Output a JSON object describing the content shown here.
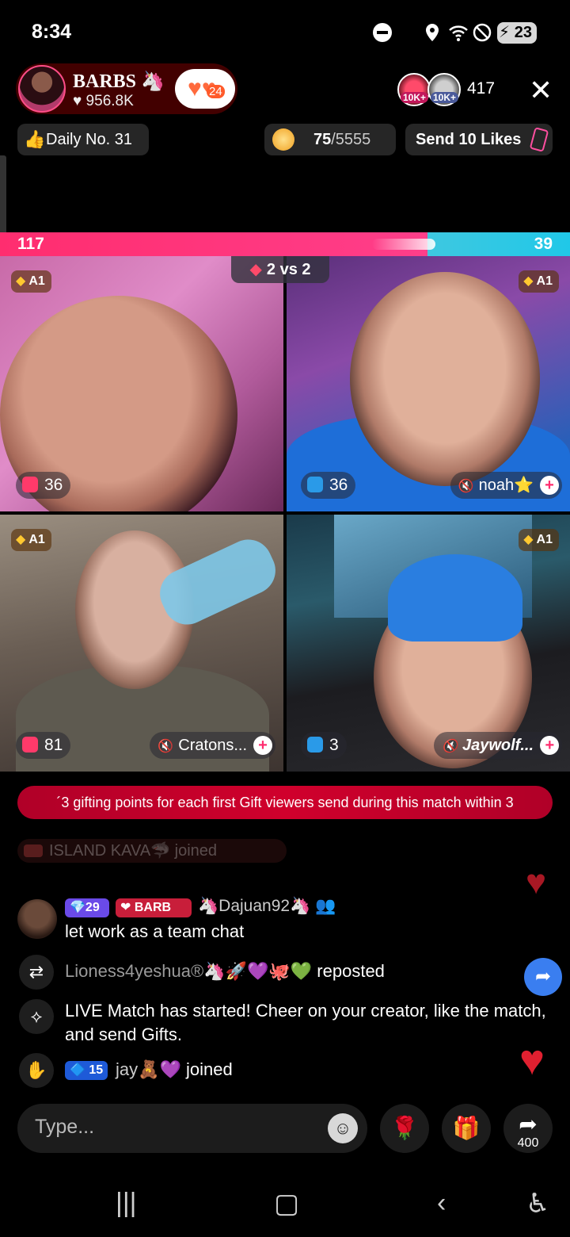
{
  "status_bar": {
    "time": "8:34",
    "battery": "23",
    "icons": [
      "dnd-icon",
      "location-icon",
      "wifi-icon",
      "no-sim-icon",
      "battery-charging-icon"
    ]
  },
  "host": {
    "name": "BARBS 🦄",
    "likes": "♥ 956.8K",
    "follow_count": "24"
  },
  "viewers": {
    "badge_1": "10K+",
    "badge_2": "10K+",
    "count": "417"
  },
  "top_row": {
    "daily": "Daily No. 31",
    "goal_current": "75",
    "goal_total": "/5555",
    "send_likes": "Send 10 Likes"
  },
  "battle": {
    "score_left": "117",
    "score_right": "39",
    "score_left_fraction": 0.75,
    "mode": "2 vs 2",
    "rank_label": "A1",
    "tiles": [
      {
        "points": "36",
        "team": "red",
        "name": ""
      },
      {
        "points": "36",
        "team": "blue",
        "name": "noah⭐"
      },
      {
        "points": "81",
        "team": "red",
        "name": "Cratons..."
      },
      {
        "points": "3",
        "team": "blue",
        "name": "Jaywolf..."
      }
    ]
  },
  "banner": {
    "text": "´3 gifting points for each first Gift viewers send during this match within 3"
  },
  "faint_row": {
    "text": "ISLAND KAVA🦈 joined"
  },
  "chat": {
    "msg1": {
      "level": "💎29",
      "fan_badge": "❤ BARB",
      "user": "🦄Dajuan92🦄",
      "text": "let work as a team chat"
    },
    "repost": {
      "user": "Lioness4yeshua®🦄🚀💜🐙💚",
      "action": " reposted"
    },
    "live_msg": "LIVE Match has started! Cheer on your creator, like the match, and send Gifts.",
    "join": {
      "level": "🔷 15",
      "user": "jay🧸💜",
      "action": " joined"
    }
  },
  "input": {
    "placeholder": "Type...",
    "share_count": "400"
  },
  "colors": {
    "red_team": "#ff2d6f",
    "blue_team": "#20c8e8",
    "banner": "#c8002a"
  }
}
